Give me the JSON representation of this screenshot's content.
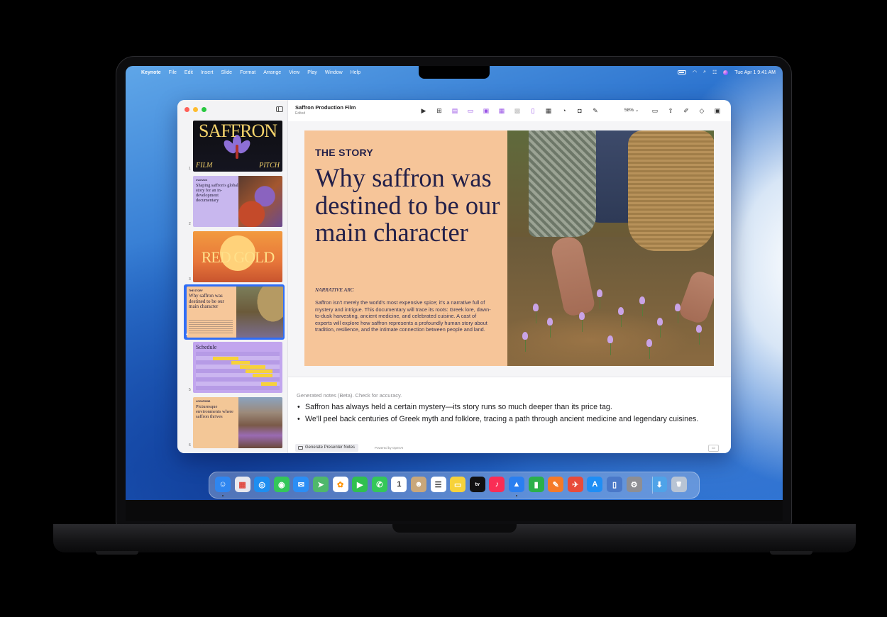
{
  "menubar": {
    "app": "Keynote",
    "items": [
      "File",
      "Edit",
      "Insert",
      "Slide",
      "Format",
      "Arrange",
      "View",
      "Play",
      "Window",
      "Help"
    ],
    "datetime": "Tue Apr 1  9:41 AM"
  },
  "document": {
    "title": "Saffron Production Film",
    "status": "Edited"
  },
  "toolbar": {
    "zoom": "58%",
    "icons": [
      "play-icon",
      "add-slide-icon",
      "text-box-icon",
      "shape-icon",
      "media-icon",
      "chart-icon",
      "image-icon",
      "document-icon",
      "table-icon",
      "chart-pie-icon",
      "shape-square-icon",
      "attachment-icon",
      "comment-icon",
      "share-icon",
      "format-brush-icon",
      "animate-icon",
      "document-panel-icon"
    ]
  },
  "thumbnails": [
    {
      "number": "1",
      "title": "SAFFRON",
      "left_caption": "FILM",
      "right_caption": "PITCH"
    },
    {
      "number": "2",
      "kicker": "OVERVIEW",
      "text": "Shaping saffron's global story for an in-development documentary"
    },
    {
      "number": "3",
      "title": "RED GOLD"
    },
    {
      "number": "4",
      "kicker": "THE STORY",
      "text": "Why saffron was destined to be our main character"
    },
    {
      "number": "5",
      "title": "Schedule"
    },
    {
      "number": "6",
      "kicker": "LOCATIONS",
      "text": "Picturesque environments where saffron thrives"
    }
  ],
  "slide": {
    "kicker": "THE STORY",
    "headline": "Why saffron was destined to be our main character",
    "section_label": "NARRATIVE ARC",
    "body": "Saffron isn't merely the world's most expensive spice; it's a narrative full of mystery and intrigue. This documentary will trace its roots: Greek lore, dawn-to-dusk harvesting, ancient medicine, and celebrated cuisine. A cast of experts will explore how saffron represents a profoundly human story about tradition, resilience, and the intimate connection between people and land."
  },
  "notes": {
    "label": "Generated notes (Beta). Check for accuracy.",
    "bullets": [
      "Saffron has always held a certain mystery—its story runs so much deeper than its price tag.",
      "We'll peel back centuries of Greek myth and folklore, tracing a path through ancient medicine and legendary cuisines."
    ],
    "generate_button": "Generate Presenter Notes",
    "powered_by": "Powered by OpenAI"
  },
  "dock": {
    "icons": [
      {
        "name": "finder-icon",
        "color": "#2f86f0",
        "glyph": "☺"
      },
      {
        "name": "launchpad-icon",
        "color": "#e8e8ee",
        "glyph": "▦"
      },
      {
        "name": "safari-icon",
        "color": "#1e8ef0",
        "glyph": "◎"
      },
      {
        "name": "messages-icon",
        "color": "#34c759",
        "glyph": "◉"
      },
      {
        "name": "mail-icon",
        "color": "#2b8ef5",
        "glyph": "✉"
      },
      {
        "name": "maps-icon",
        "color": "#4fb86b",
        "glyph": "➤"
      },
      {
        "name": "photos-icon",
        "color": "#ffffff",
        "glyph": "✿"
      },
      {
        "name": "facetime-icon",
        "color": "#30c04f",
        "glyph": "▶"
      },
      {
        "name": "phone-icon",
        "color": "#34c759",
        "glyph": "✆"
      },
      {
        "name": "calendar-icon",
        "color": "#ffffff",
        "glyph": "1"
      },
      {
        "name": "contacts-icon",
        "color": "#c9a77a",
        "glyph": "☻"
      },
      {
        "name": "reminders-icon",
        "color": "#ffffff",
        "glyph": "☰"
      },
      {
        "name": "notes-icon",
        "color": "#f7d23a",
        "glyph": "▭"
      },
      {
        "name": "tv-icon",
        "color": "#111111",
        "glyph": "tv"
      },
      {
        "name": "music-icon",
        "color": "#fa2d55",
        "glyph": "♪"
      },
      {
        "name": "keynote-icon",
        "color": "#2a7ff0",
        "glyph": "▲"
      },
      {
        "name": "numbers-icon",
        "color": "#2bb04a",
        "glyph": "▮"
      },
      {
        "name": "pages-icon",
        "color": "#f57a28",
        "glyph": "✎"
      },
      {
        "name": "testflight-icon",
        "color": "#e84b3a",
        "glyph": "✈"
      },
      {
        "name": "app-store-icon",
        "color": "#1f8ef5",
        "glyph": "A"
      },
      {
        "name": "iphone-mirroring-icon",
        "color": "#4a78c8",
        "glyph": "▯"
      },
      {
        "name": "system-settings-icon",
        "color": "#8e8e93",
        "glyph": "⚙"
      },
      {
        "name": "downloads-folder-icon",
        "color": "#4fa3e8",
        "glyph": "⬇"
      },
      {
        "name": "trash-icon",
        "color": "#b8c4d4",
        "glyph": "🗑"
      }
    ]
  },
  "colors": {
    "slide_background": "#f6c599",
    "slide_text": "#232049",
    "selection": "#2f6df6",
    "accent_purple": "#9a55e6"
  }
}
